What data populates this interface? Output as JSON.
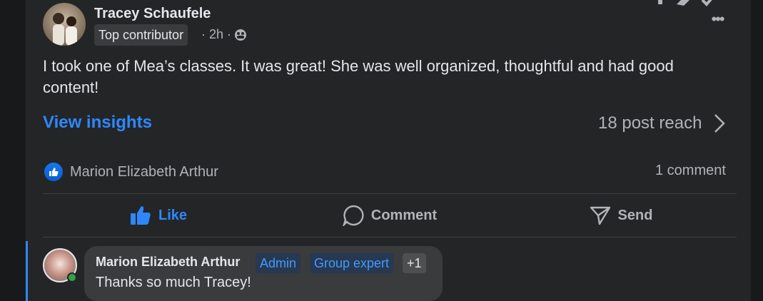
{
  "post": {
    "author": "Tracey Schaufele",
    "badge": "Top contributor",
    "meta_time": "· 2h ·",
    "privacy_icon": "group-privacy-icon",
    "text": "I took one of Mea’s classes. It was great! She was well organized, thoughtful and had good content!",
    "more_label": "•••"
  },
  "insights": {
    "view_label": "View insights",
    "reach_label": "18 post reach"
  },
  "reactions": {
    "reactor": "Marion Elizabeth Arthur",
    "comment_count": "1 comment"
  },
  "actions": {
    "like": "Like",
    "comment": "Comment",
    "send": "Send"
  },
  "comment": {
    "author": "Marion Elizabeth Arthur",
    "tags": [
      "Admin",
      "Group expert",
      "+1"
    ],
    "text": "Thanks so much Tracey!"
  },
  "colors": {
    "accent": "#2d88ff",
    "card_bg": "#242526",
    "bubble_bg": "#3a3b3c",
    "online": "#31a24c"
  }
}
